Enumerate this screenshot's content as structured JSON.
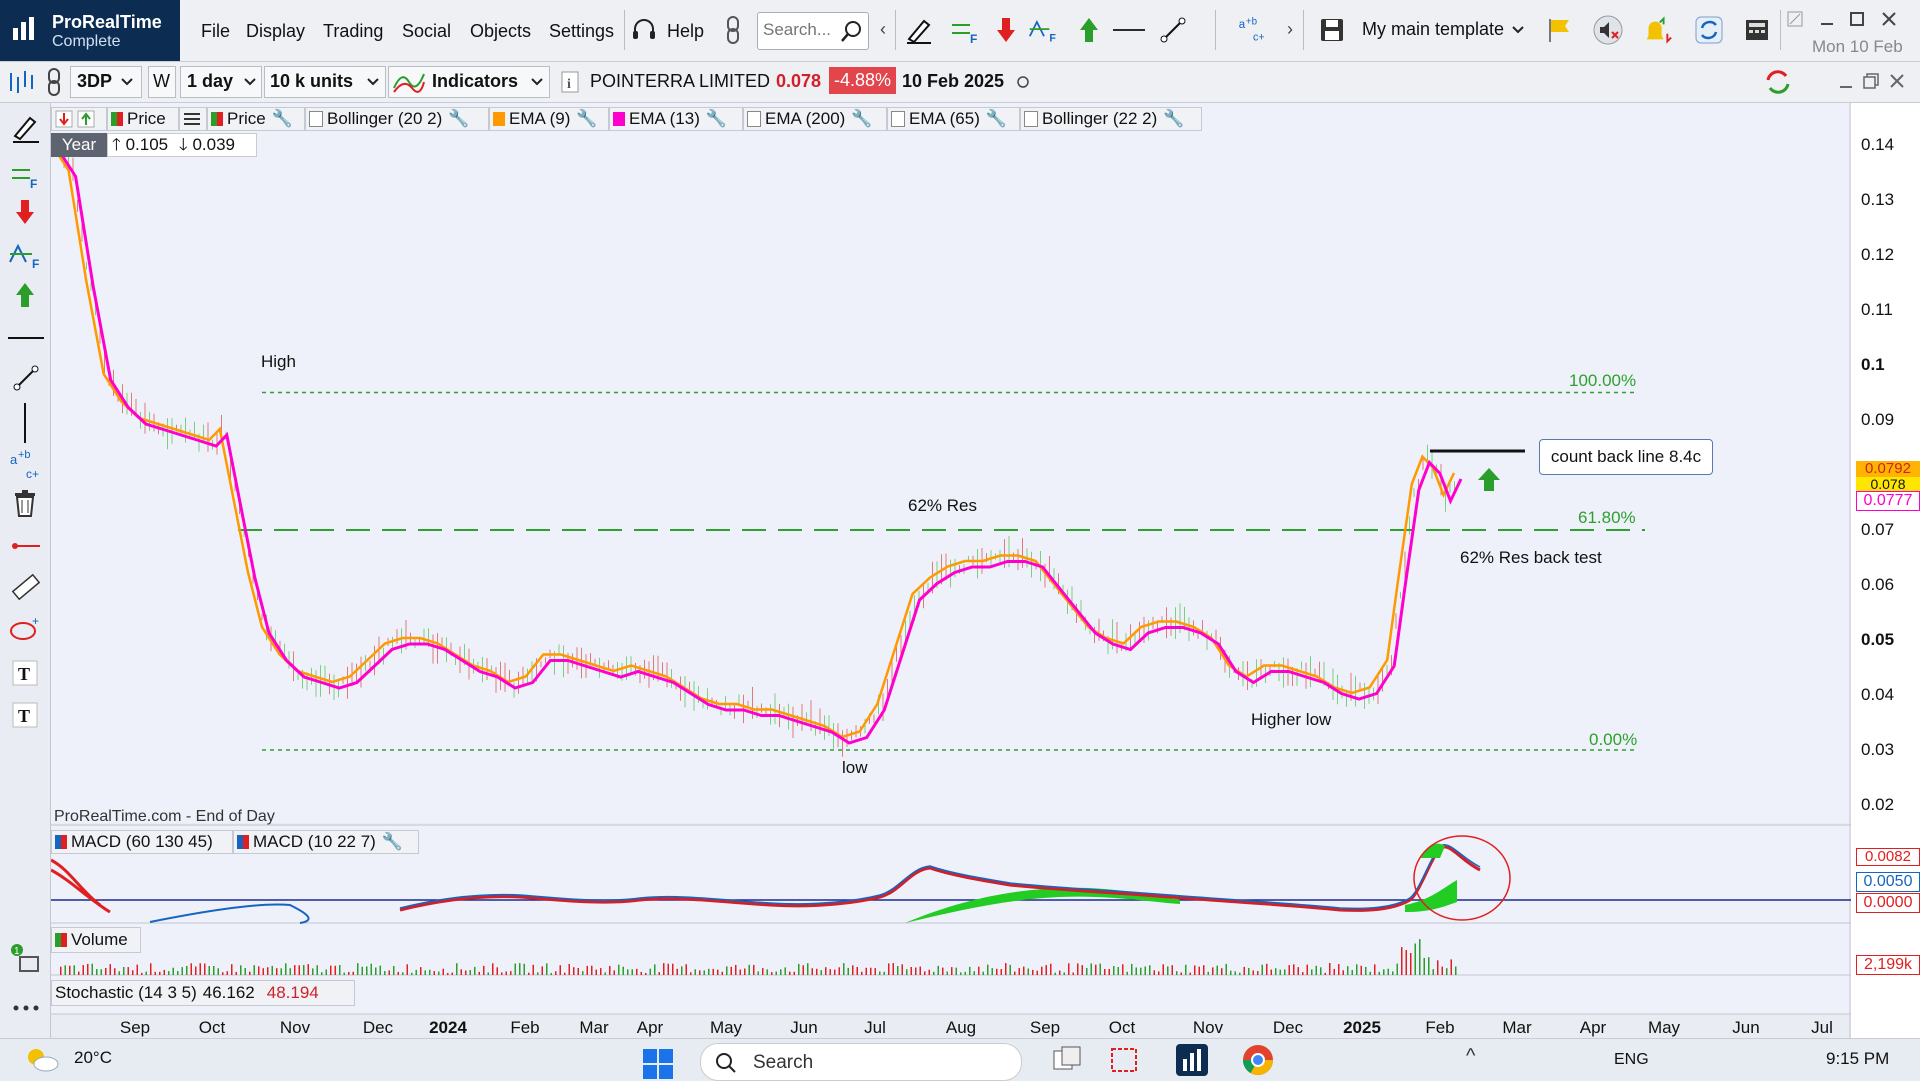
{
  "app": {
    "name": "ProRealTime",
    "edition": "Complete"
  },
  "menu": [
    "File",
    "Display",
    "Trading",
    "Social",
    "Objects",
    "Settings"
  ],
  "help_label": "Help",
  "search": {
    "placeholder": "Search..."
  },
  "template": {
    "label": "My main template"
  },
  "date_top": "Mon 10 Feb",
  "toolbar2": {
    "code": "3DP",
    "period_btn": "W",
    "interval": "1 day",
    "units": "10 k units",
    "indicators": "Indicators",
    "company": "POINTERRA LIMITED",
    "price": "0.078",
    "change": "-4.88%",
    "date": "10 Feb 2025"
  },
  "legend": [
    "Price",
    "Price",
    "Bollinger (20 2)",
    "EMA (9)",
    "EMA (13)",
    "EMA (200)",
    "EMA (65)",
    "Bollinger (22 2)"
  ],
  "range_box": {
    "period": "Year",
    "high": "0.105",
    "low": "0.039"
  },
  "chart_data": {
    "type": "line",
    "title": "POINTERRA LIMITED (3DP) daily",
    "x": [
      "Sep",
      "Oct",
      "Nov",
      "Dec",
      "2024",
      "Feb",
      "Mar",
      "Apr",
      "May",
      "Jun",
      "Jul",
      "Aug",
      "Sep",
      "Oct",
      "Nov",
      "Dec",
      "2025",
      "Feb",
      "Mar",
      "Apr",
      "May",
      "Jun",
      "Jul"
    ],
    "y_ticks": [
      "0.14",
      "0.13",
      "0.12",
      "0.11",
      "0.1",
      "0.09",
      "0.08",
      "0.07",
      "0.06",
      "0.05",
      "0.04",
      "0.03",
      "0.02"
    ],
    "y_range": [
      0.02,
      0.14
    ],
    "series": [
      {
        "name": "EMA (9)",
        "color": "#ff9900"
      },
      {
        "name": "EMA (13)",
        "color": "#ff00cc"
      }
    ],
    "price_path": [
      [
        0,
        0.14
      ],
      [
        0.5,
        0.135
      ],
      [
        1,
        0.115
      ],
      [
        1.5,
        0.098
      ],
      [
        2,
        0.093
      ],
      [
        2.5,
        0.09
      ],
      [
        3,
        0.089
      ],
      [
        3.5,
        0.088
      ],
      [
        4,
        0.087
      ],
      [
        4.5,
        0.086
      ],
      [
        4.8,
        0.088
      ],
      [
        5.2,
        0.075
      ],
      [
        5.6,
        0.062
      ],
      [
        6,
        0.052
      ],
      [
        6.5,
        0.047
      ],
      [
        7,
        0.044
      ],
      [
        7.5,
        0.043
      ],
      [
        8,
        0.042
      ],
      [
        8.5,
        0.043
      ],
      [
        9,
        0.046
      ],
      [
        9.5,
        0.049
      ],
      [
        10,
        0.05
      ],
      [
        10.5,
        0.05
      ],
      [
        11,
        0.049
      ],
      [
        11.5,
        0.047
      ],
      [
        12,
        0.045
      ],
      [
        12.5,
        0.044
      ],
      [
        13,
        0.042
      ],
      [
        13.5,
        0.043
      ],
      [
        14,
        0.047
      ],
      [
        14.5,
        0.047
      ],
      [
        15,
        0.046
      ],
      [
        15.5,
        0.045
      ],
      [
        16,
        0.044
      ],
      [
        16.5,
        0.045
      ],
      [
        17,
        0.044
      ],
      [
        17.5,
        0.043
      ],
      [
        18,
        0.041
      ],
      [
        18.5,
        0.039
      ],
      [
        19,
        0.038
      ],
      [
        19.5,
        0.038
      ],
      [
        20,
        0.037
      ],
      [
        20.5,
        0.037
      ],
      [
        21,
        0.036
      ],
      [
        21.5,
        0.035
      ],
      [
        22,
        0.034
      ],
      [
        22.5,
        0.032
      ],
      [
        23,
        0.033
      ],
      [
        23.5,
        0.038
      ],
      [
        24,
        0.048
      ],
      [
        24.5,
        0.058
      ],
      [
        25,
        0.061
      ],
      [
        25.5,
        0.063
      ],
      [
        26,
        0.064
      ],
      [
        26.5,
        0.064
      ],
      [
        27,
        0.065
      ],
      [
        27.5,
        0.065
      ],
      [
        28,
        0.064
      ],
      [
        28.5,
        0.06
      ],
      [
        29,
        0.056
      ],
      [
        29.5,
        0.052
      ],
      [
        30,
        0.05
      ],
      [
        30.5,
        0.049
      ],
      [
        31,
        0.052
      ],
      [
        31.5,
        0.053
      ],
      [
        32,
        0.053
      ],
      [
        32.5,
        0.052
      ],
      [
        33,
        0.05
      ],
      [
        33.5,
        0.045
      ],
      [
        34,
        0.043
      ],
      [
        34.5,
        0.045
      ],
      [
        35,
        0.045
      ],
      [
        35.5,
        0.044
      ],
      [
        36,
        0.043
      ],
      [
        36.5,
        0.041
      ],
      [
        37,
        0.04
      ],
      [
        37.5,
        0.041
      ],
      [
        38,
        0.046
      ],
      [
        38.3,
        0.06
      ],
      [
        38.7,
        0.078
      ],
      [
        39,
        0.083
      ],
      [
        39.3,
        0.081
      ],
      [
        39.6,
        0.076
      ],
      [
        39.9,
        0.08
      ]
    ],
    "levels": [
      {
        "label": "100.00%",
        "value": 0.095,
        "color": "#2ea02e"
      },
      {
        "label": "61.80%",
        "value": 0.07,
        "color": "#2ea02e"
      },
      {
        "label": "0.00%",
        "value": 0.03,
        "color": "#2ea02e"
      }
    ],
    "annotations": [
      "High",
      "62% Res",
      "low",
      "Higher low",
      "62% Res back test",
      "count back line 8.4c"
    ],
    "price_badges": [
      "0.0792",
      "0.078",
      "0.0777"
    ]
  },
  "footer_label": "ProRealTime.com - End of Day",
  "macd": {
    "legend": [
      "MACD (60 130 45)",
      "MACD (10 22 7)"
    ],
    "badges": [
      "0.0082",
      "0.0050",
      "0.0000"
    ]
  },
  "volume": {
    "label": "Volume",
    "badge": "2,199k"
  },
  "stochastic": {
    "label": "Stochastic (14 3 5)",
    "v1": "46.162",
    "v2": "48.194"
  },
  "taskbar": {
    "temp": "20°C",
    "search": "Search",
    "lang": "ENG",
    "time": "9:15 PM"
  }
}
